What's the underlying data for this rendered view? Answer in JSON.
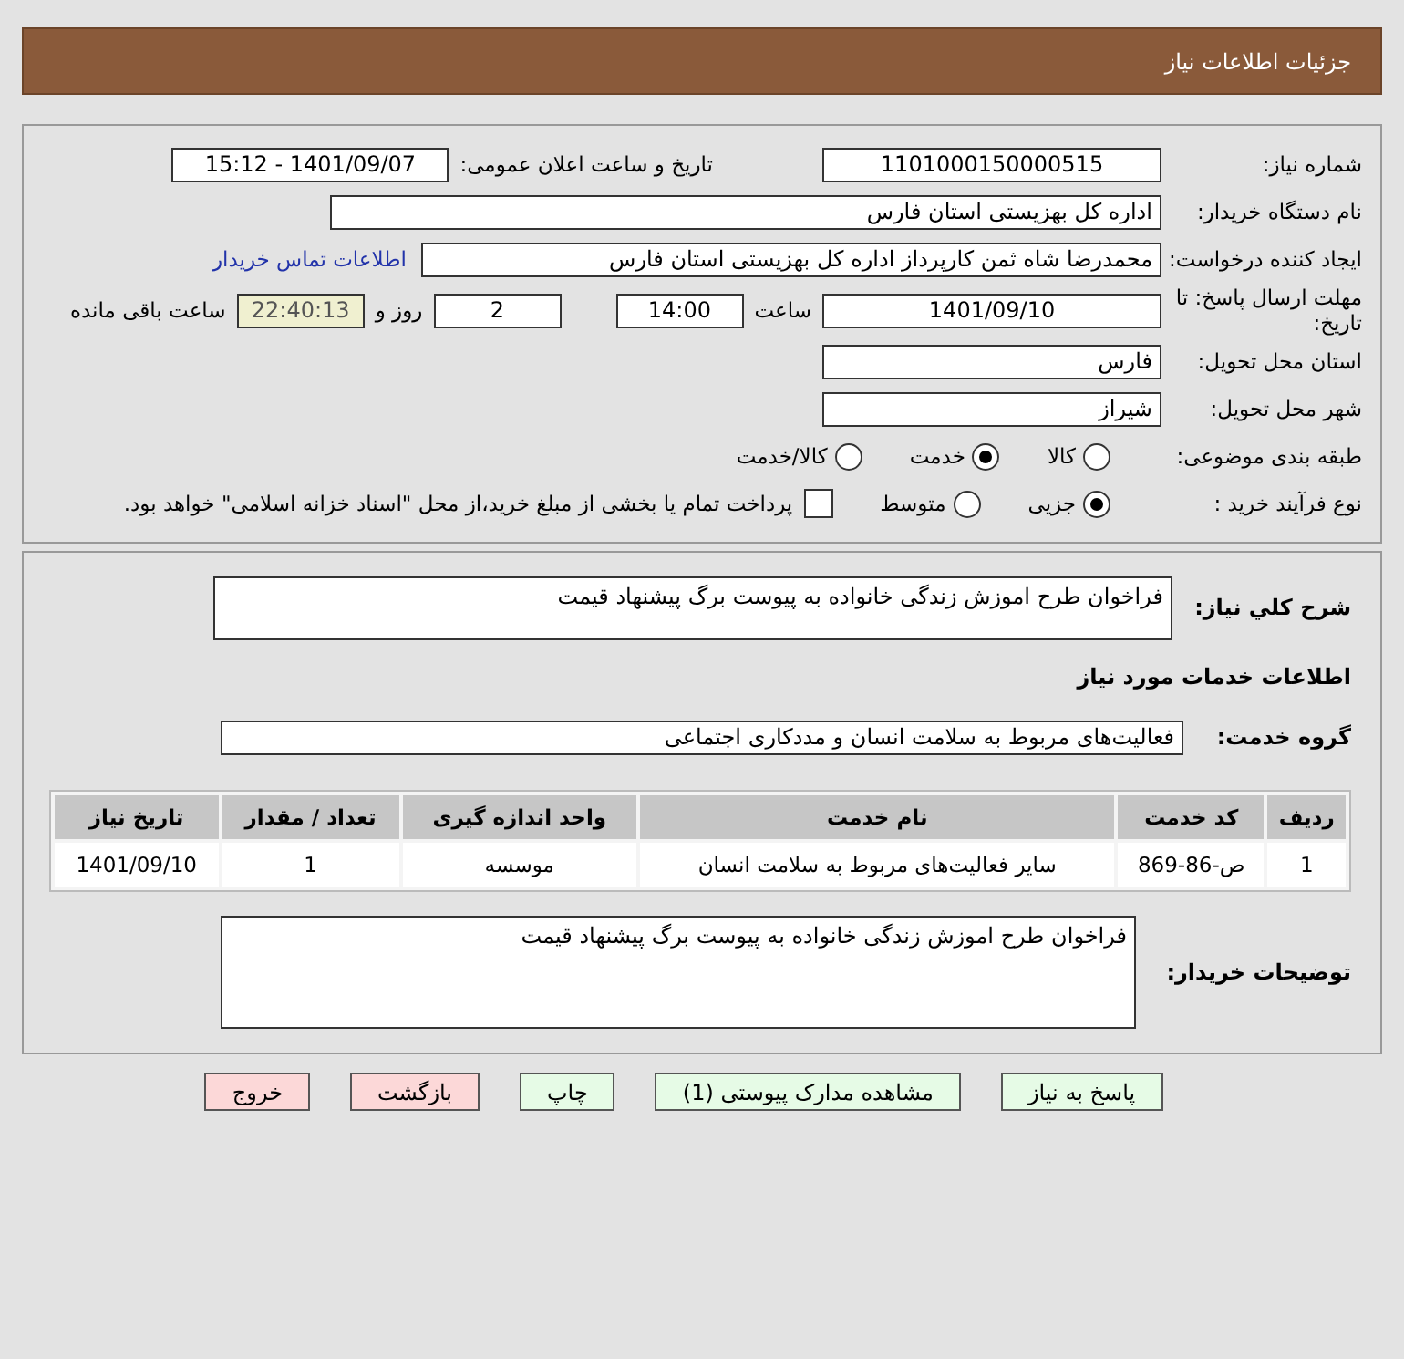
{
  "header": {
    "title": "جزئیات اطلاعات نیاز"
  },
  "need_number": {
    "label": "شماره نیاز:",
    "value": "1101000150000515"
  },
  "announce": {
    "label": "تاریخ و ساعت اعلان عمومی:",
    "value": "1401/09/07 - 15:12"
  },
  "buyer_org": {
    "label": "نام دستگاه خریدار:",
    "value": "اداره کل بهزیستی استان فارس"
  },
  "creator": {
    "label": "ایجاد کننده درخواست:",
    "value": "محمدرضا شاه ثمن کارپرداز اداره کل بهزیستی استان فارس",
    "link": "اطلاعات تماس خریدار"
  },
  "deadline": {
    "label": "مهلت ارسال پاسخ: تا تاریخ:",
    "date": "1401/09/10",
    "time_label": "ساعت",
    "time": "14:00",
    "days": "2",
    "days_label": "روز و",
    "remaining": "22:40:13",
    "remaining_label": "ساعت باقی مانده"
  },
  "province": {
    "label": "استان محل تحویل:",
    "value": "فارس"
  },
  "city": {
    "label": "شهر محل تحویل:",
    "value": "شیراز"
  },
  "category": {
    "label": "طبقه بندی موضوعی:",
    "options": [
      {
        "label": "کالا",
        "selected": false
      },
      {
        "label": "خدمت",
        "selected": true
      },
      {
        "label": "کالا/خدمت",
        "selected": false
      }
    ]
  },
  "process": {
    "label": "نوع فرآیند خرید :",
    "options": [
      {
        "label": "جزیی",
        "selected": true
      },
      {
        "label": "متوسط",
        "selected": false
      }
    ],
    "payment": {
      "label": "پرداخت تمام یا بخشی از مبلغ خرید،از محل \"اسناد خزانه اسلامی\" خواهد بود.",
      "checked": false
    }
  },
  "description": {
    "label": "شرح کلي نياز:",
    "value": "فراخوان طرح اموزش زندگی خانواده به پیوست برگ پیشنهاد قیمت"
  },
  "services_heading": "اطلاعات خدمات مورد نیاز",
  "service_group": {
    "label": "گروه خدمت:",
    "value": "فعالیت‌های مربوط به سلامت انسان و مددکاری اجتماعی"
  },
  "table": {
    "columns": [
      "ردیف",
      "کد خدمت",
      "نام خدمت",
      "واحد اندازه گیری",
      "تعداد / مقدار",
      "تاریخ نیاز"
    ],
    "rows": [
      [
        "1",
        "ص-86-869",
        "سایر فعالیت‌های مربوط به سلامت انسان",
        "موسسه",
        "1",
        "1401/09/10"
      ]
    ]
  },
  "buyer_notes": {
    "label": "توضیحات خریدار:",
    "value": "فراخوان طرح اموزش زندگی خانواده به پیوست برگ پیشنهاد قیمت"
  },
  "buttons": [
    {
      "label": "پاسخ به نیاز",
      "kind": "action"
    },
    {
      "label": "مشاهده مدارک پیوستی (1)",
      "kind": "action"
    },
    {
      "label": "چاپ",
      "kind": "action"
    },
    {
      "label": "بازگشت",
      "kind": "exit"
    },
    {
      "label": "خروج",
      "kind": "exit"
    }
  ]
}
